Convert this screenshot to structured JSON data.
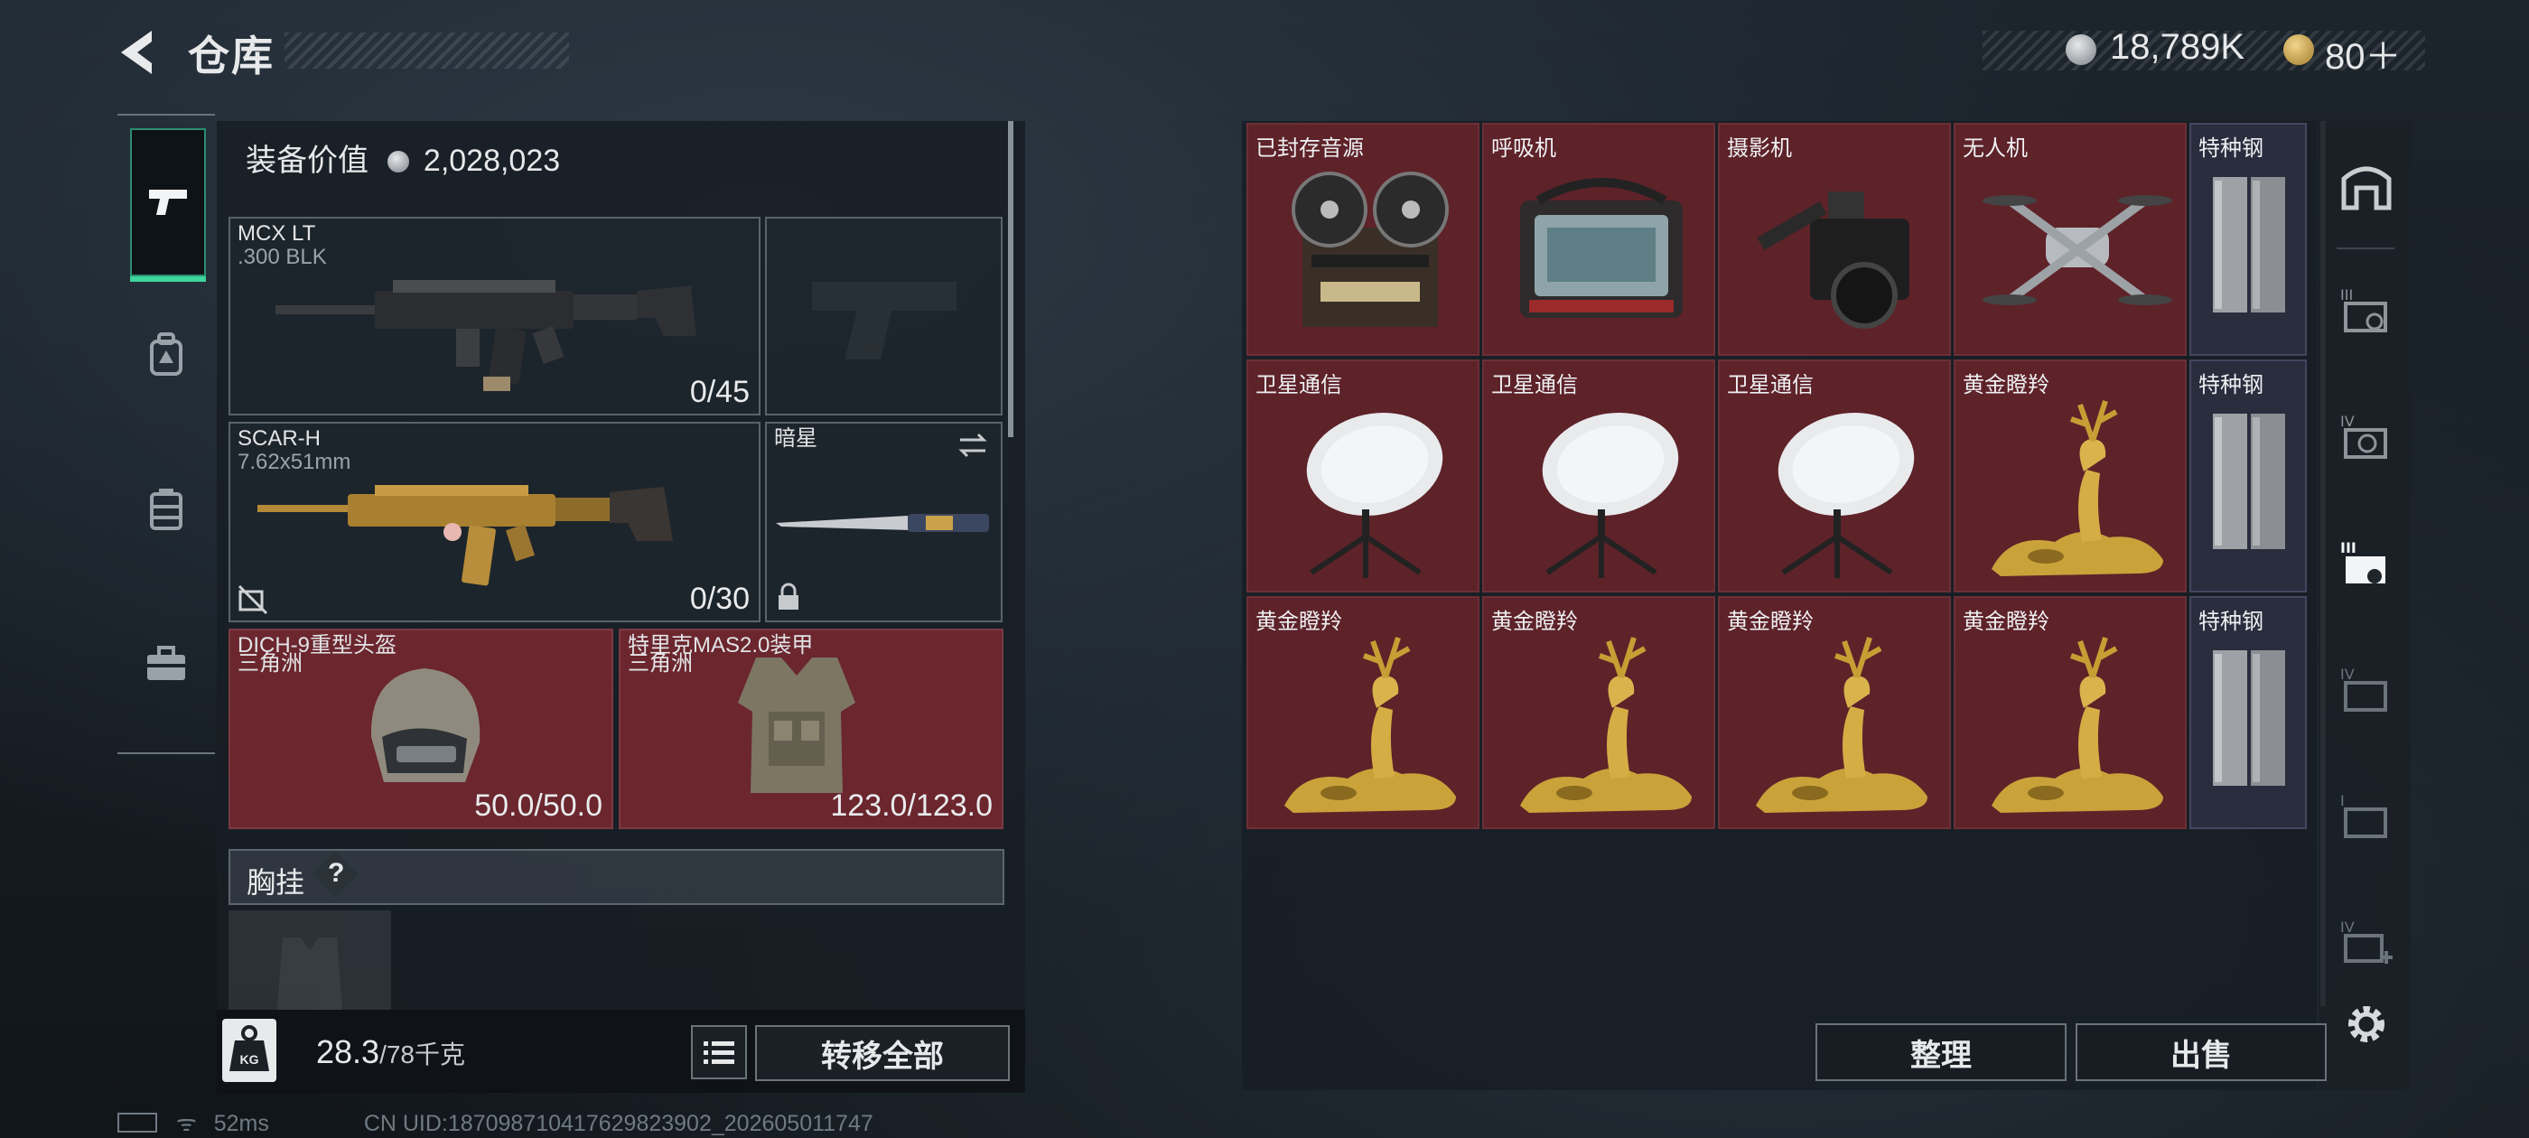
{
  "header": {
    "title": "仓库",
    "currency_main": "18,789K",
    "currency_secondary": "80＋"
  },
  "nav": {
    "items": [
      {
        "icon": "pistol-icon",
        "active": true
      },
      {
        "icon": "backpack-icon",
        "active": false
      },
      {
        "icon": "vest-icon",
        "active": false
      },
      {
        "icon": "toolbox-icon",
        "active": false
      }
    ]
  },
  "equipment": {
    "value_label": "装备价值",
    "value": "2,028,023",
    "primary_weapon": {
      "name": "MCX LT",
      "ammo": ".300 BLK",
      "count": "0/45"
    },
    "secondary_weapon": {
      "name": "SCAR-H",
      "ammo": "7.62x51mm",
      "count": "0/30"
    },
    "melee": {
      "name": "暗星"
    },
    "helmet": {
      "name": "DICH-9重型头盔",
      "origin": "三角洲",
      "durability": "50.0/50.0"
    },
    "armor": {
      "name": "特里克MAS2.0装甲",
      "origin": "三角洲",
      "durability": "123.0/123.0"
    },
    "chest_rig_label": "胸挂",
    "chest_rig_help": "?"
  },
  "footer_left": {
    "weight": "28.3",
    "weight_max": "/78千克",
    "transfer_all": "转移全部"
  },
  "storage": {
    "items": [
      {
        "name": "已封存音源",
        "kind": "reel",
        "row": 0,
        "col": 0
      },
      {
        "name": "呼吸机",
        "kind": "ventilator",
        "row": 0,
        "col": 1
      },
      {
        "name": "摄影机",
        "kind": "camera",
        "row": 0,
        "col": 2
      },
      {
        "name": "无人机",
        "kind": "drone",
        "row": 0,
        "col": 3
      },
      {
        "name": "特种钢",
        "kind": "steel",
        "row": 0,
        "col": 4
      },
      {
        "name": "卫星通信",
        "kind": "dish",
        "row": 1,
        "col": 0
      },
      {
        "name": "卫星通信",
        "kind": "dish",
        "row": 1,
        "col": 1
      },
      {
        "name": "卫星通信",
        "kind": "dish",
        "row": 1,
        "col": 2
      },
      {
        "name": "黄金瞪羚",
        "kind": "gazelle",
        "row": 1,
        "col": 3
      },
      {
        "name": "特种钢",
        "kind": "steel",
        "row": 1,
        "col": 4
      },
      {
        "name": "黄金瞪羚",
        "kind": "gazelle",
        "row": 2,
        "col": 0
      },
      {
        "name": "黄金瞪羚",
        "kind": "gazelle",
        "row": 2,
        "col": 1
      },
      {
        "name": "黄金瞪羚",
        "kind": "gazelle",
        "row": 2,
        "col": 2
      },
      {
        "name": "黄金瞪羚",
        "kind": "gazelle",
        "row": 2,
        "col": 3
      },
      {
        "name": "特种钢",
        "kind": "steel",
        "row": 2,
        "col": 4
      }
    ],
    "sort_button": "整理",
    "sell_button": "出售"
  },
  "status": {
    "ping": "52ms",
    "uid": "CN UID:18709871041762982390​2_202605011747"
  },
  "colors": {
    "accent_green": "#3fd49c",
    "item_red": "#5e2229",
    "steel_blue": "#2a2d3d"
  }
}
